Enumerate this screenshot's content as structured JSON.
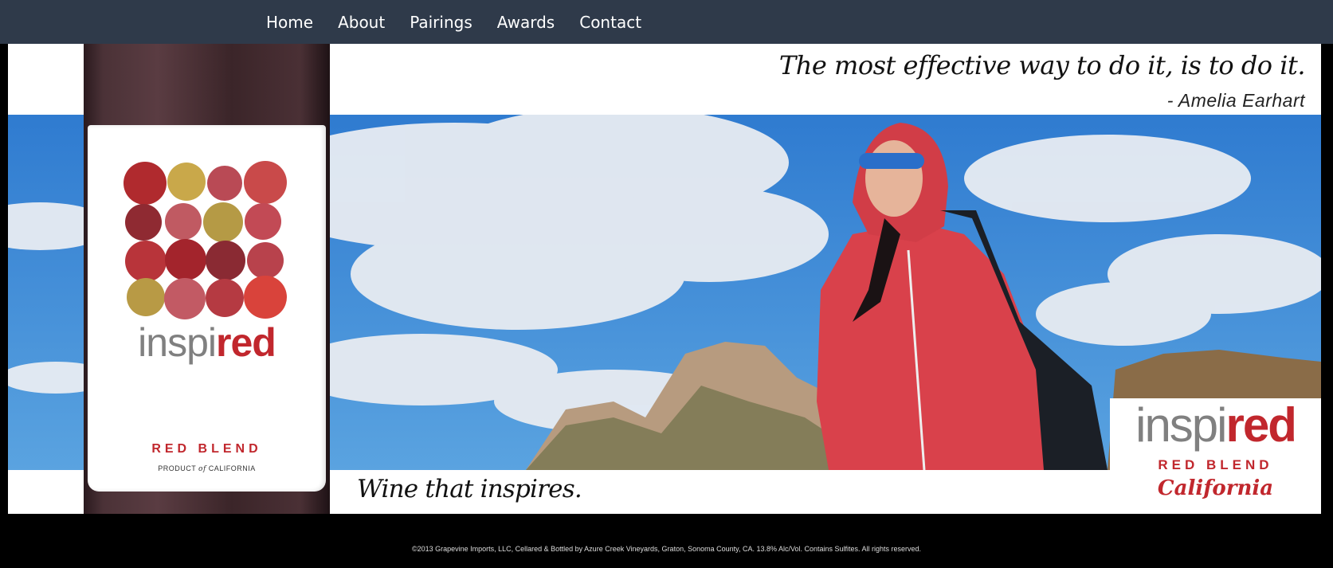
{
  "nav": {
    "items": [
      {
        "label": "Home"
      },
      {
        "label": "About"
      },
      {
        "label": "Pairings"
      },
      {
        "label": "Awards"
      },
      {
        "label": "Contact"
      }
    ]
  },
  "banner": {
    "quote": "The most effective way to do it, is to do it.",
    "quote_author": "- Amelia Earhart",
    "tagline": "Wine that inspires."
  },
  "bottle_label": {
    "brand_light": "inspi",
    "brand_bold": "red",
    "variety": "RED BLEND",
    "origin_prefix": "PRODUCT ",
    "origin_of": "of",
    "origin_suffix": " CALIFORNIA"
  },
  "badge": {
    "brand_light": "inspi",
    "brand_bold": "red",
    "variety": "RED BLEND",
    "region": "California"
  },
  "footer": {
    "text": "©2013 Grapevine Imports, LLC, Cellared & Bottled by Azure Creek Vineyards, Graton, Sonoma County, CA. 13.8% Alc/Vol. Contains Sulfites. All rights reserved."
  },
  "colors": {
    "nav_bg": "#2f3a4a",
    "brand_red": "#c1272d",
    "brand_gray": "#808080",
    "sky": "#3d8ad4",
    "hoodie": "#d9414b"
  }
}
